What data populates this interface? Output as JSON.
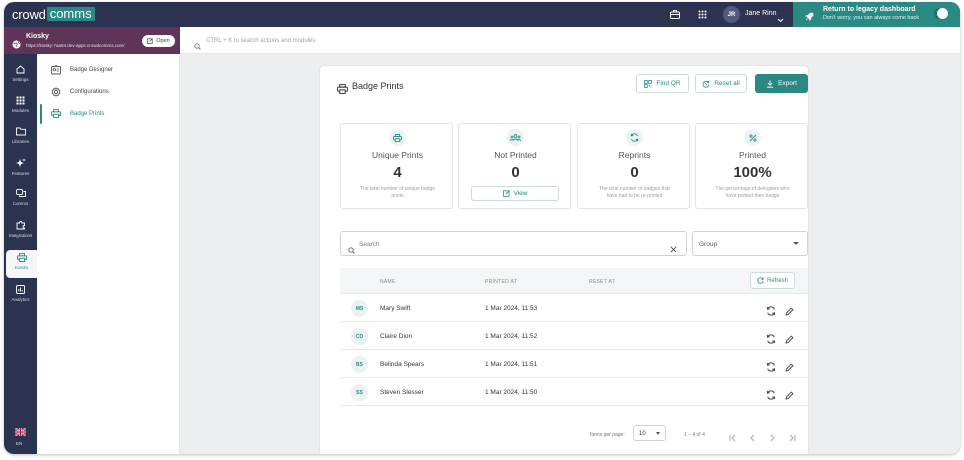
{
  "brand": {
    "part1": "crowd",
    "part2": "comms"
  },
  "topbar": {
    "user_initials": "JR",
    "user_name": "Jane Rinn",
    "legacy_title": "Return to legacy dashboard",
    "legacy_subtitle": "Don't worry, you can always come back"
  },
  "kiosk": {
    "name": "Kiosky",
    "url": "https://kiosky-7aa84.dev-apps.crowdcomms.com/",
    "open_label": "Open"
  },
  "search": {
    "placeholder": "CTRL + K to search actions and modules"
  },
  "rail": {
    "items": [
      {
        "label": "Settings",
        "icon": "home-icon"
      },
      {
        "label": "Modules",
        "icon": "grid-icon"
      },
      {
        "label": "Libraries",
        "icon": "folder-icon"
      },
      {
        "label": "Features",
        "icon": "sparkle-icon"
      },
      {
        "label": "Comms",
        "icon": "chat-icon"
      },
      {
        "label": "Integrations",
        "icon": "puzzle-icon"
      },
      {
        "label": "Kiosks",
        "icon": "printer-icon"
      },
      {
        "label": "Analytics",
        "icon": "chart-icon"
      }
    ],
    "language": "EN"
  },
  "subnav": {
    "items": [
      {
        "label": "Badge Designer"
      },
      {
        "label": "Configurations"
      },
      {
        "label": "Badge Prints"
      }
    ]
  },
  "panel": {
    "title": "Badge Prints",
    "find_qr": "Find QR",
    "reset_all": "Reset all",
    "export": "Export"
  },
  "cards": [
    {
      "title": "Unique Prints",
      "value": "4",
      "desc": "The total number of unique badge prints"
    },
    {
      "title": "Not Printed",
      "value": "0",
      "action": "View"
    },
    {
      "title": "Reprints",
      "value": "0",
      "desc": "The total number of badges that have had to be re-printed"
    },
    {
      "title": "Printed",
      "value": "100%",
      "desc": "The percentage of delegates who have printed their badge"
    }
  ],
  "filters": {
    "search_placeholder": "Search",
    "group_placeholder": "Group"
  },
  "table": {
    "headers": {
      "name": "NAME",
      "printed_at": "PRINTED AT",
      "reset_at": "RESET AT"
    },
    "refresh": "Refresh",
    "rows": [
      {
        "initials": "MS",
        "name": "Mary Swift",
        "printed_at": "1 Mar 2024, 11:53",
        "reset_at": ""
      },
      {
        "initials": "CD",
        "name": "Claire Dion",
        "printed_at": "1 Mar 2024, 11:52",
        "reset_at": ""
      },
      {
        "initials": "BS",
        "name": "Belinda Spears",
        "printed_at": "1 Mar 2024, 11:51",
        "reset_at": ""
      },
      {
        "initials": "SS",
        "name": "Steven Slesser",
        "printed_at": "1 Mar 2024, 11:50",
        "reset_at": ""
      }
    ]
  },
  "pager": {
    "items_per_page_label": "Items per page:",
    "items_per_page": "10",
    "range": "1 – 4 of 4"
  },
  "colors": {
    "accent": "#2a8a83",
    "nav": "#2c3350",
    "kiosk_bar": "#5e3558"
  }
}
